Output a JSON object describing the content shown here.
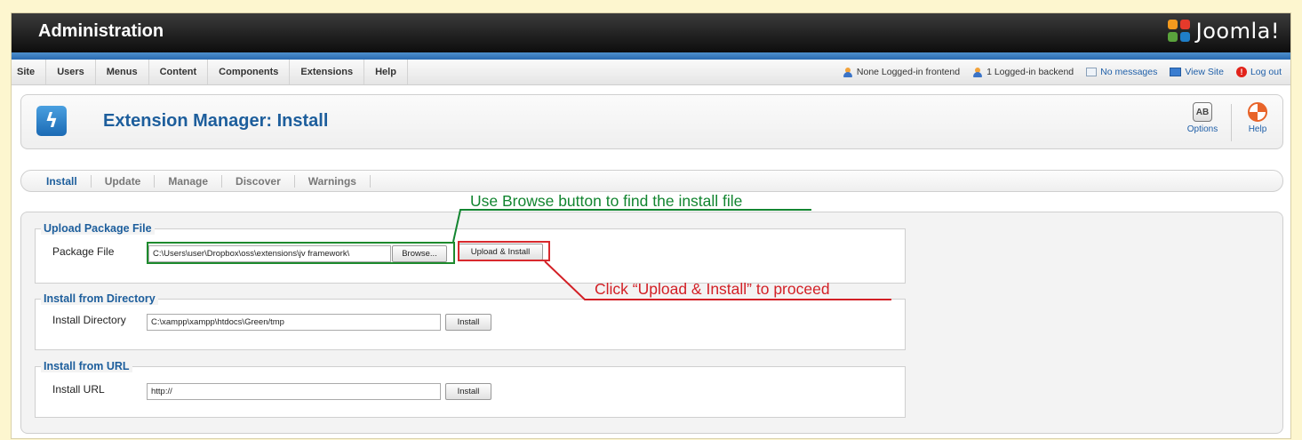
{
  "header": {
    "title": "Administration",
    "logo_text": "Joomla!"
  },
  "menu": {
    "items": [
      "Site",
      "Users",
      "Menus",
      "Content",
      "Components",
      "Extensions",
      "Help"
    ]
  },
  "status": {
    "frontend": "None Logged-in frontend",
    "backend": "1 Logged-in backend",
    "messages": "No messages",
    "view_site": "View Site",
    "logout": "Log out"
  },
  "toolbar": {
    "icon_glyph": "ϟ",
    "title": "Extension Manager: Install",
    "options_label": "Options",
    "options_icon_glyph": "AB",
    "help_label": "Help"
  },
  "tabs": [
    "Install",
    "Update",
    "Manage",
    "Discover",
    "Warnings"
  ],
  "upload": {
    "legend": "Upload Package File",
    "label": "Package File",
    "value": "C:\\Users\\user\\Dropbox\\oss\\extensions\\jv framework\\",
    "browse_label": "Browse...",
    "install_label": "Upload & Install"
  },
  "directory": {
    "legend": "Install from Directory",
    "label": "Install Directory",
    "value": "C:\\xampp\\xampp\\htdocs\\Green/tmp",
    "install_label": "Install"
  },
  "url": {
    "legend": "Install from URL",
    "label": "Install URL",
    "value": "http://",
    "install_label": "Install"
  },
  "annotations": {
    "browse_hint": "Use Browse button to find the install file",
    "upload_hint": "Click “Upload & Install” to proceed"
  },
  "colors": {
    "accent_blue": "#1d5e9c",
    "annotation_green": "#128530",
    "annotation_red": "#d32026",
    "page_background": "#fdf6cf"
  }
}
